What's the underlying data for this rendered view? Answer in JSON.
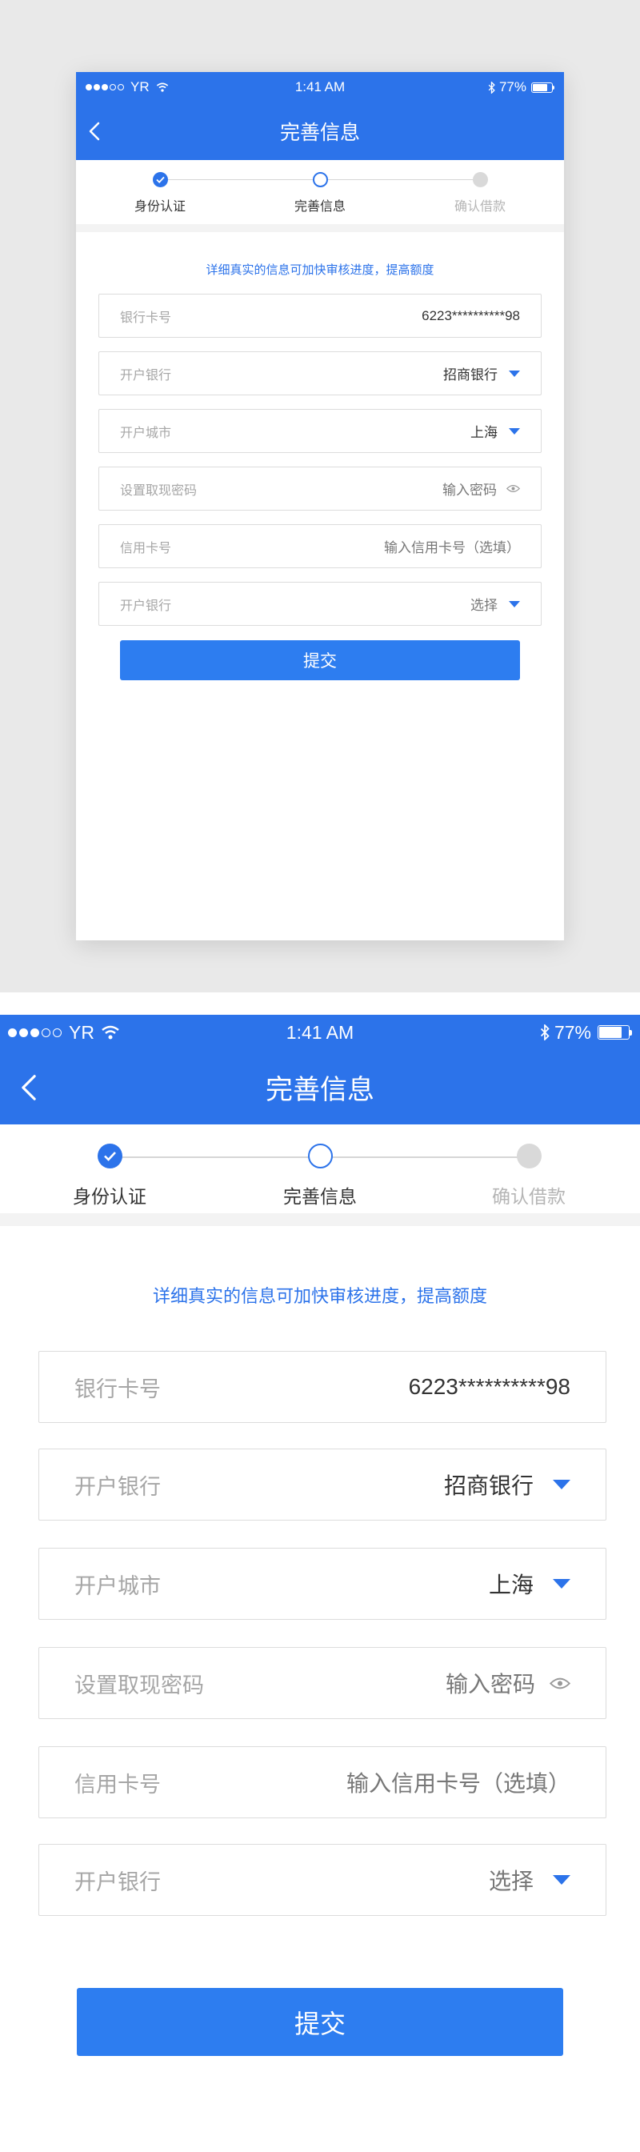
{
  "status_bar": {
    "carrier": "YR",
    "time": "1:41 AM",
    "battery": "77%",
    "battery_level": 0.77
  },
  "header": {
    "title": "完善信息"
  },
  "steps": [
    {
      "label": "身份认证",
      "state": "done"
    },
    {
      "label": "完善信息",
      "state": "current"
    },
    {
      "label": "确认借款",
      "state": "pending"
    }
  ],
  "notice": "详细真实的信息可加快审核进度，提高额度",
  "form": {
    "bank_card": {
      "label": "银行卡号",
      "value": "6223**********98"
    },
    "open_bank": {
      "label": "开户银行",
      "value": "招商银行"
    },
    "open_city": {
      "label": "开户城市",
      "value": "上海"
    },
    "withdraw_password": {
      "label": "设置取现密码",
      "placeholder": "输入密码"
    },
    "credit_card": {
      "label": "信用卡号",
      "placeholder": "输入信用卡号（选填）"
    },
    "open_bank_2": {
      "label": "开户银行",
      "placeholder": "选择"
    }
  },
  "submit_label": "提交",
  "colors": {
    "primary": "#2c73ea",
    "button": "#2d7df0",
    "page_bg": "#e9e9e9",
    "field_border": "#dcdcdc",
    "pending": "#d9d9d9"
  },
  "icons": [
    "back-arrow-icon",
    "wifi-icon",
    "bluetooth-icon",
    "battery-icon",
    "check-icon",
    "dropdown-caret-icon",
    "eye-icon"
  ]
}
